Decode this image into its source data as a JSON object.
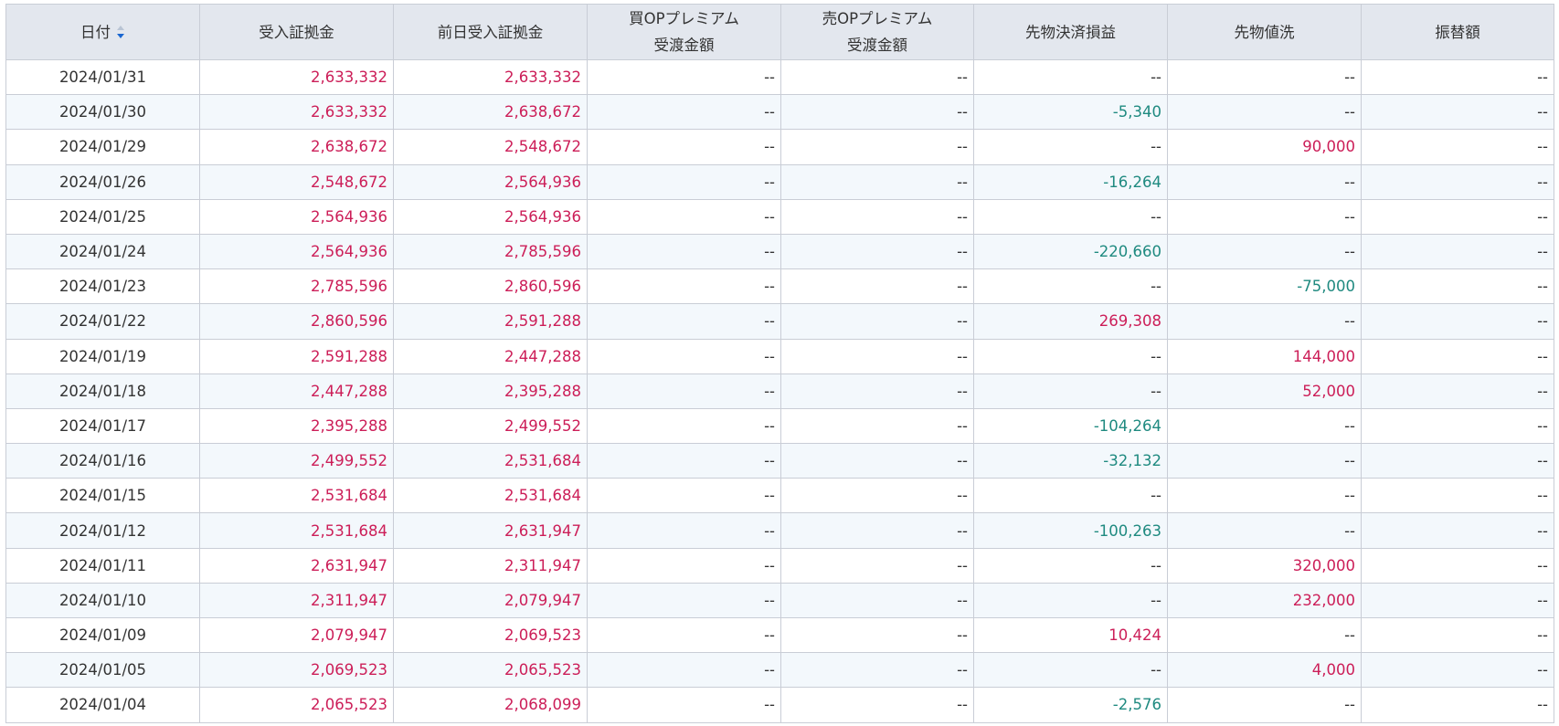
{
  "table": {
    "columns": [
      {
        "lines": [
          "日付"
        ]
      },
      {
        "lines": [
          "受入証拠金"
        ]
      },
      {
        "lines": [
          "前日受入証拠金"
        ]
      },
      {
        "lines": [
          "買OPプレミアム",
          "受渡金額"
        ]
      },
      {
        "lines": [
          "売OPプレミアム",
          "受渡金額"
        ]
      },
      {
        "lines": [
          "先物決済損益"
        ]
      },
      {
        "lines": [
          "先物値洗"
        ]
      },
      {
        "lines": [
          "振替額"
        ]
      }
    ],
    "sort": {
      "column": "日付",
      "direction": "desc",
      "icon": "sort-desc-icon",
      "active_color": "#1a66d1",
      "inactive_color": "#b9c4d4"
    },
    "colors": {
      "positive": "#cc1e58",
      "negative": "#1f8a80",
      "neutral": "#333333",
      "header_bg": "#e3e7ee",
      "row_alt_bg": "#f3f8fc"
    },
    "rows": [
      [
        "2024/01/31",
        "2,633,332",
        "2,633,332",
        "--",
        "--",
        "--",
        "--",
        "--"
      ],
      [
        "2024/01/30",
        "2,633,332",
        "2,638,672",
        "--",
        "--",
        "-5,340",
        "--",
        "--"
      ],
      [
        "2024/01/29",
        "2,638,672",
        "2,548,672",
        "--",
        "--",
        "--",
        "90,000",
        "--"
      ],
      [
        "2024/01/26",
        "2,548,672",
        "2,564,936",
        "--",
        "--",
        "-16,264",
        "--",
        "--"
      ],
      [
        "2024/01/25",
        "2,564,936",
        "2,564,936",
        "--",
        "--",
        "--",
        "--",
        "--"
      ],
      [
        "2024/01/24",
        "2,564,936",
        "2,785,596",
        "--",
        "--",
        "-220,660",
        "--",
        "--"
      ],
      [
        "2024/01/23",
        "2,785,596",
        "2,860,596",
        "--",
        "--",
        "--",
        "-75,000",
        "--"
      ],
      [
        "2024/01/22",
        "2,860,596",
        "2,591,288",
        "--",
        "--",
        "269,308",
        "--",
        "--"
      ],
      [
        "2024/01/19",
        "2,591,288",
        "2,447,288",
        "--",
        "--",
        "--",
        "144,000",
        "--"
      ],
      [
        "2024/01/18",
        "2,447,288",
        "2,395,288",
        "--",
        "--",
        "--",
        "52,000",
        "--"
      ],
      [
        "2024/01/17",
        "2,395,288",
        "2,499,552",
        "--",
        "--",
        "-104,264",
        "--",
        "--"
      ],
      [
        "2024/01/16",
        "2,499,552",
        "2,531,684",
        "--",
        "--",
        "-32,132",
        "--",
        "--"
      ],
      [
        "2024/01/15",
        "2,531,684",
        "2,531,684",
        "--",
        "--",
        "--",
        "--",
        "--"
      ],
      [
        "2024/01/12",
        "2,531,684",
        "2,631,947",
        "--",
        "--",
        "-100,263",
        "--",
        "--"
      ],
      [
        "2024/01/11",
        "2,631,947",
        "2,311,947",
        "--",
        "--",
        "--",
        "320,000",
        "--"
      ],
      [
        "2024/01/10",
        "2,311,947",
        "2,079,947",
        "--",
        "--",
        "--",
        "232,000",
        "--"
      ],
      [
        "2024/01/09",
        "2,079,947",
        "2,069,523",
        "--",
        "--",
        "10,424",
        "--",
        "--"
      ],
      [
        "2024/01/05",
        "2,069,523",
        "2,065,523",
        "--",
        "--",
        "--",
        "4,000",
        "--"
      ],
      [
        "2024/01/04",
        "2,065,523",
        "2,068,099",
        "--",
        "--",
        "-2,576",
        "--",
        "--"
      ]
    ]
  }
}
